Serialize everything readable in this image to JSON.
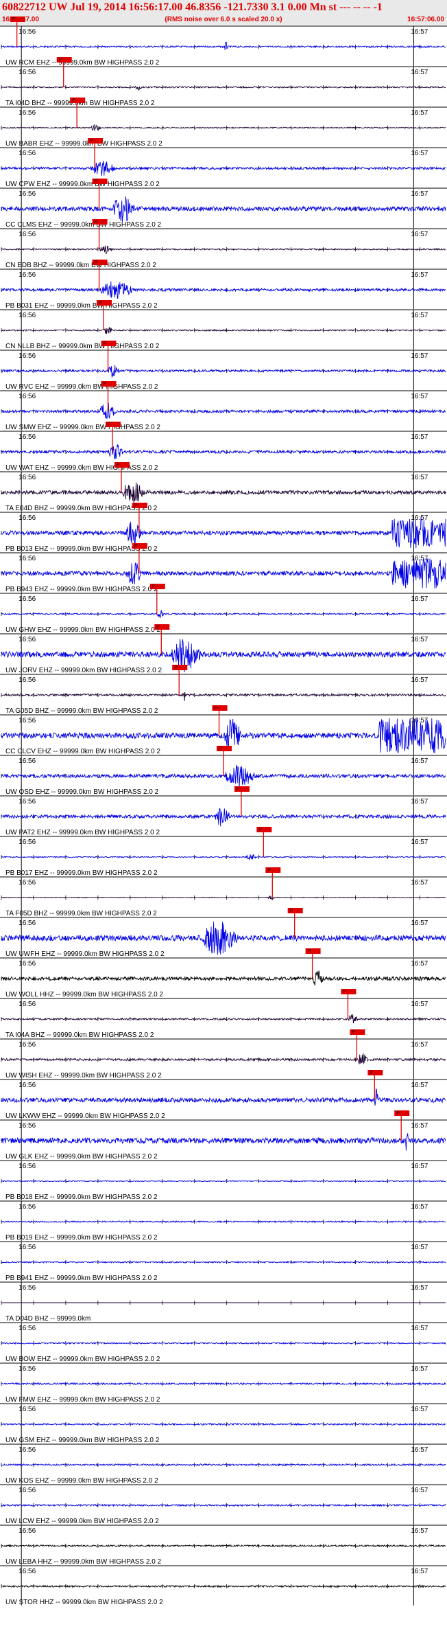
{
  "header": {
    "title": "60822712 UW Jul 19, 2014 16:56:17.00    46.8356 -121.7330  3.1 0.00 Mn st --- -- --  -1",
    "start_time": "16:55:57.00",
    "note": "(RMS noise over 6.0 s scaled 20.0 x)",
    "end_time": "16:57:06.00"
  },
  "colors": {
    "header": "#e00000",
    "trace_blue": "#0000e6",
    "trace_dark": "#1a0030",
    "trace_black": "#000000",
    "pick": "#e00000"
  },
  "chart_data": {
    "type": "line",
    "description_type": "seismogram record section",
    "time_range": [
      "16:55:57.00",
      "16:57:06.00"
    ],
    "tick_labels": [
      "16:56",
      "16:57"
    ],
    "pick_label": "P",
    "traces": [
      {
        "label": "UW RCM EHZ -- 99999.0km BW  HIGHPASS  2.0  2",
        "color": "blue",
        "pick": 0.035,
        "amp": 0.6,
        "burst": [
          0.5,
          0.56
        ]
      },
      {
        "label": "TA I04D BHZ -- 99999.0km BW  HIGHPASS  2.0  2",
        "color": "dark",
        "pick": 0.14,
        "amp": 0.5,
        "burst": [
          0.3,
          0.4
        ]
      },
      {
        "label": "UW BABR EHZ -- 99999.0km BW  HIGHPASS  2.0  2",
        "color": "dark",
        "pick": 0.17,
        "amp": 0.4,
        "burst": [
          0.2,
          0.35
        ]
      },
      {
        "label": "UW CPW EHZ -- 99999.0km BW  HIGHPASS  2.0  2",
        "color": "blue",
        "pick": 0.21,
        "amp": 0.9,
        "burst": [
          0.2,
          0.55
        ]
      },
      {
        "label": "CC CLMS EHZ -- 99999.0km BW  HIGHPASS  2.0  2",
        "color": "blue",
        "pick": 0.22,
        "amp": 1.6,
        "burst": [
          0.25,
          0.55
        ]
      },
      {
        "label": "CN EDB BHZ -- 99999.0km BW  HIGHPASS  2.0  2",
        "color": "dark",
        "pick": 0.22,
        "amp": 0.5,
        "burst": [
          0.22,
          0.4
        ]
      },
      {
        "label": "PB B031 EHZ -- 99999.0km BW  HIGHPASS  2.0  2",
        "color": "blue",
        "pick": 0.22,
        "amp": 1.0,
        "burst": [
          0.22,
          0.7
        ]
      },
      {
        "label": "CN NLLB BHZ -- 99999.0km BW  HIGHPASS  2.0  2",
        "color": "dark",
        "pick": 0.23,
        "amp": 0.5,
        "burst": [
          0.23,
          0.35
        ]
      },
      {
        "label": "UW RVC EHZ -- 99999.0km BW  HIGHPASS  2.0  2",
        "color": "blue",
        "pick": 0.24,
        "amp": 0.8,
        "burst": [
          0.24,
          0.4
        ]
      },
      {
        "label": "UW SMW EHZ -- 99999.0km BW  HIGHPASS  2.0  2",
        "color": "blue",
        "pick": 0.24,
        "amp": 1.0,
        "burst": [
          0.22,
          0.45
        ]
      },
      {
        "label": "UW WAT EHZ -- 99999.0km BW  HIGHPASS  2.0  2",
        "color": "blue",
        "pick": 0.25,
        "amp": 1.0,
        "burst": [
          0.24,
          0.45
        ]
      },
      {
        "label": "TA E04D BHZ -- 99999.0km BW  HIGHPASS  2.0  2",
        "color": "dark",
        "pick": 0.27,
        "amp": 1.3,
        "burst": [
          0.27,
          0.6
        ]
      },
      {
        "label": "PB B013 EHZ -- 99999.0km BW  HIGHPASS  2.0  2",
        "color": "blue",
        "pick": 0.31,
        "amp": 1.5,
        "burst": [
          0.28,
          0.5
        ],
        "burst2": [
          0.88,
          1.0
        ]
      },
      {
        "label": "PB B943 EHZ -- 99999.0km BW  HIGHPASS  2.0  2",
        "color": "blue",
        "pick": 0.31,
        "amp": 1.5,
        "burst": [
          0.28,
          0.5
        ],
        "burst2": [
          0.88,
          1.0
        ]
      },
      {
        "label": "UW GHW EHZ -- 99999.0km BW  HIGHPASS  2.0  2",
        "color": "blue",
        "pick": 0.35,
        "amp": 0.5,
        "burst": [
          0.35,
          0.45
        ]
      },
      {
        "label": "UW JORV EHZ -- 99999.0km BW  HIGHPASS  2.0  2",
        "color": "blue",
        "pick": 0.36,
        "amp": 2.0,
        "burst": [
          0.38,
          0.8
        ]
      },
      {
        "label": "TA G05D BHZ -- 99999.0km BW  HIGHPASS  2.0  2",
        "color": "dark",
        "pick": 0.4,
        "amp": 0.8,
        "burst": [
          0.41,
          0.44
        ]
      },
      {
        "label": "CC CLCV EHZ -- 99999.0km BW  HIGHPASS  2.0  2",
        "color": "blue",
        "pick": 0.49,
        "amp": 2.0,
        "burst": [
          0.5,
          0.75
        ],
        "burst2": [
          0.85,
          1.0
        ]
      },
      {
        "label": "UW OSD EHZ -- 99999.0km BW  HIGHPASS  2.0  2",
        "color": "blue",
        "pick": 0.5,
        "amp": 1.3,
        "burst": [
          0.5,
          0.95
        ]
      },
      {
        "label": "UW PAT2 EHZ -- 99999.0km BW  HIGHPASS  2.0  2",
        "color": "blue",
        "pick": 0.54,
        "amp": 1.2,
        "burst": [
          0.48,
          0.7
        ]
      },
      {
        "label": "PB B017 EHZ -- 99999.0km BW  HIGHPASS  2.0  2",
        "color": "blue",
        "pick": 0.59,
        "amp": 0.4,
        "burst": [
          0.55,
          0.7
        ]
      },
      {
        "label": "TA F05D BHZ -- 99999.0km BW  HIGHPASS  2.0  2",
        "color": "dark",
        "pick": 0.61,
        "amp": 0.3,
        "burst": [
          0.6,
          0.7
        ]
      },
      {
        "label": "UW UWFH EHZ -- 99999.0km BW  HIGHPASS  2.0  2",
        "color": "blue",
        "pick": 0.66,
        "amp": 2.0,
        "burst": [
          0.45,
          0.95
        ]
      },
      {
        "label": "UW WOLL HHZ -- 99999.0km BW  HIGHPASS  2.0  2",
        "color": "black",
        "pick": 0.7,
        "amp": 1.3,
        "burst": [
          0.7,
          0.85
        ]
      },
      {
        "label": "TA I04A BHZ -- 99999.0km BW  HIGHPASS  2.0  2",
        "color": "dark",
        "pick": 0.78,
        "amp": 0.6,
        "burst": [
          0.78,
          0.92
        ]
      },
      {
        "label": "UW WISH EHZ -- 99999.0km BW  HIGHPASS  2.0  2",
        "color": "dark",
        "pick": 0.8,
        "amp": 0.8,
        "burst": [
          0.8,
          0.95
        ]
      },
      {
        "label": "UW LKWW EHZ -- 99999.0km BW  HIGHPASS  2.0  2",
        "color": "blue",
        "pick": 0.84,
        "amp": 1.6,
        "burst": [
          0.84,
          0.9
        ]
      },
      {
        "label": "UW GLK EHZ -- 99999.0km BW  HIGHPASS  2.0  2",
        "color": "blue",
        "pick": 0.9,
        "amp": 2.0,
        "burst": [
          0.91,
          0.95
        ]
      },
      {
        "label": "PB B018 EHZ -- 99999.0km BW  HIGHPASS  2.0  2",
        "color": "blue",
        "pick": null,
        "amp": 0.3,
        "burst": null
      },
      {
        "label": "PB B019 EHZ -- 99999.0km BW  HIGHPASS  2.0  2",
        "color": "blue",
        "pick": null,
        "amp": 0.5,
        "burst": null
      },
      {
        "label": "PB B941 EHZ -- 99999.0km BW  HIGHPASS  2.0  2",
        "color": "blue",
        "pick": null,
        "amp": 0.5,
        "burst": null
      },
      {
        "label": "TA D04D BHZ -- 99999.0km",
        "color": "dark",
        "pick": null,
        "amp": 0.0,
        "burst": null
      },
      {
        "label": "UW BOW EHZ -- 99999.0km BW  HIGHPASS  2.0  2",
        "color": "blue",
        "pick": null,
        "amp": 0.5,
        "burst": null
      },
      {
        "label": "UW FMW EHZ -- 99999.0km BW  HIGHPASS  2.0  2",
        "color": "blue",
        "pick": null,
        "amp": 0.6,
        "burst": null
      },
      {
        "label": "UW GSM EHZ -- 99999.0km BW  HIGHPASS  2.0  2",
        "color": "blue",
        "pick": null,
        "amp": 0.6,
        "burst": null
      },
      {
        "label": "UW KOS EHZ -- 99999.0km BW  HIGHPASS  2.0  2",
        "color": "blue",
        "pick": null,
        "amp": 0.6,
        "burst": null
      },
      {
        "label": "UW LCW EHZ -- 99999.0km BW  HIGHPASS  2.0  2",
        "color": "blue",
        "pick": null,
        "amp": 0.6,
        "burst": null
      },
      {
        "label": "UW LEBA HHZ -- 99999.0km BW  HIGHPASS  2.0  2",
        "color": "black",
        "pick": null,
        "amp": 0.6,
        "burst": null
      },
      {
        "label": "UW STOR HHZ -- 99999.0km BW  HIGHPASS  2.0  2",
        "color": "black",
        "pick": null,
        "amp": 0.6,
        "burst": null
      }
    ]
  }
}
